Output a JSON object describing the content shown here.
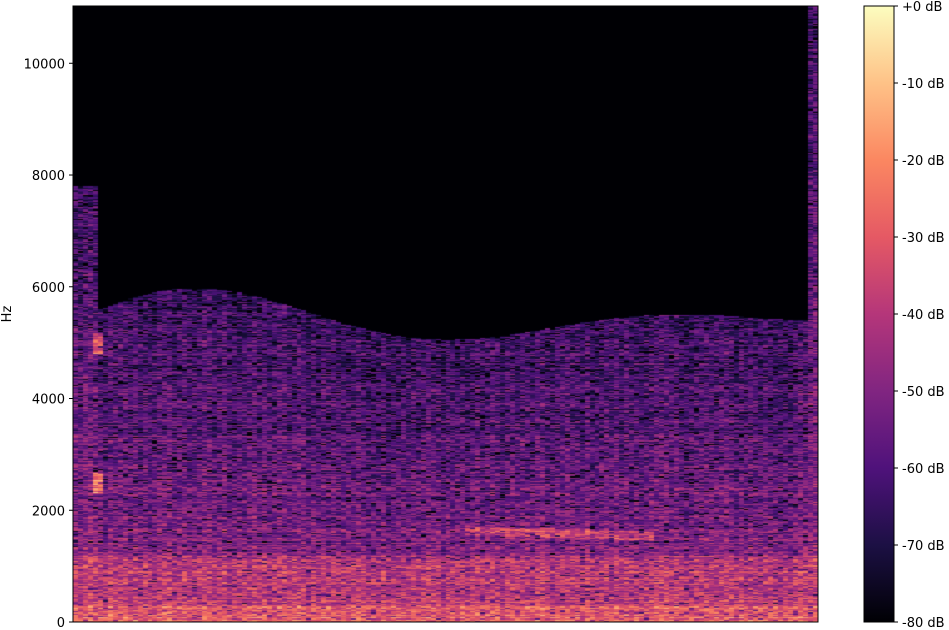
{
  "chart_data": {
    "type": "heatmap",
    "title": "",
    "xlabel": "",
    "ylabel": "Hz",
    "ylim": [
      0,
      11025
    ],
    "y_ticks": [
      {
        "value": 0,
        "label": "0"
      },
      {
        "value": 2000,
        "label": "2000"
      },
      {
        "value": 4000,
        "label": "4000"
      },
      {
        "value": 6000,
        "label": "6000"
      },
      {
        "value": 8000,
        "label": "8000"
      },
      {
        "value": 10000,
        "label": "10000"
      }
    ],
    "colorbar": {
      "colormap": "magma",
      "range_db": [
        -80,
        0
      ],
      "ticks": [
        {
          "value": 0,
          "label": "+0 dB"
        },
        {
          "value": -10,
          "label": "-10 dB"
        },
        {
          "value": -20,
          "label": "-20 dB"
        },
        {
          "value": -30,
          "label": "-30 dB"
        },
        {
          "value": -40,
          "label": "-40 dB"
        },
        {
          "value": -50,
          "label": "-50 dB"
        },
        {
          "value": -60,
          "label": "-60 dB"
        },
        {
          "value": -70,
          "label": "-70 dB"
        },
        {
          "value": -80,
          "label": "-80 dB"
        }
      ]
    },
    "grid": false,
    "colormap_stops": [
      "#000004",
      "#1c1044",
      "#4f127b",
      "#812581",
      "#b5367a",
      "#e55964",
      "#fb8761",
      "#fec287",
      "#fcfdbf"
    ]
  }
}
